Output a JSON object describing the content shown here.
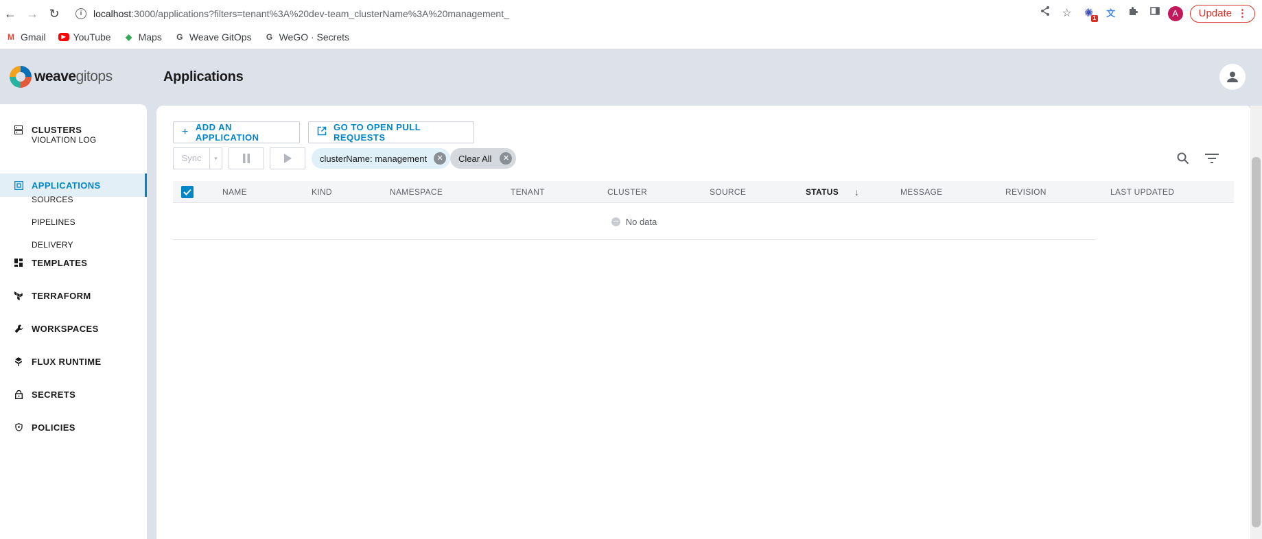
{
  "browser": {
    "url_host": "localhost",
    "url_rest": ":3000/applications?filters=tenant%3A%20dev-team_clusterName%3A%20management_",
    "extension_badge": "1",
    "profile_initial": "A",
    "update_label": "Update",
    "bookmarks": [
      {
        "label": "Gmail",
        "icon": "gmail-icon"
      },
      {
        "label": "YouTube",
        "icon": "youtube-icon"
      },
      {
        "label": "Maps",
        "icon": "maps-icon"
      },
      {
        "label": "Weave GitOps",
        "icon": "weave-icon"
      },
      {
        "label": "WeGO · Secrets",
        "icon": "weave-icon"
      }
    ]
  },
  "app": {
    "logo_bold": "weave",
    "logo_light": "gitops",
    "page_title": "Applications"
  },
  "sidebar": {
    "clusters": "CLUSTERS",
    "violation_log": "VIOLATION LOG",
    "applications": "APPLICATIONS",
    "sources": "SOURCES",
    "pipelines": "PIPELINES",
    "delivery": "DELIVERY",
    "templates": "TEMPLATES",
    "terraform": "TERRAFORM",
    "workspaces": "WORKSPACES",
    "flux_runtime": "FLUX RUNTIME",
    "secrets": "SECRETS",
    "policies": "POLICIES"
  },
  "toolbar": {
    "add_application": "ADD AN APPLICATION",
    "open_pull_requests": "GO TO OPEN PULL REQUESTS",
    "sync_label": "Sync"
  },
  "filters": {
    "active_filter": "clusterName: management",
    "clear_all": "Clear All"
  },
  "table": {
    "columns": {
      "name": "NAME",
      "kind": "KIND",
      "namespace": "NAMESPACE",
      "tenant": "TENANT",
      "cluster": "CLUSTER",
      "source": "SOURCE",
      "status": "STATUS",
      "message": "MESSAGE",
      "revision": "REVISION",
      "last_updated": "LAST UPDATED"
    },
    "empty_text": "No data"
  },
  "colors": {
    "accent": "#0085c7",
    "app_background": "#dde2ea",
    "active_nav_bg": "#e3eff6",
    "filter_chip_bg": "#e0f0f8",
    "update_red": "#d93025"
  }
}
